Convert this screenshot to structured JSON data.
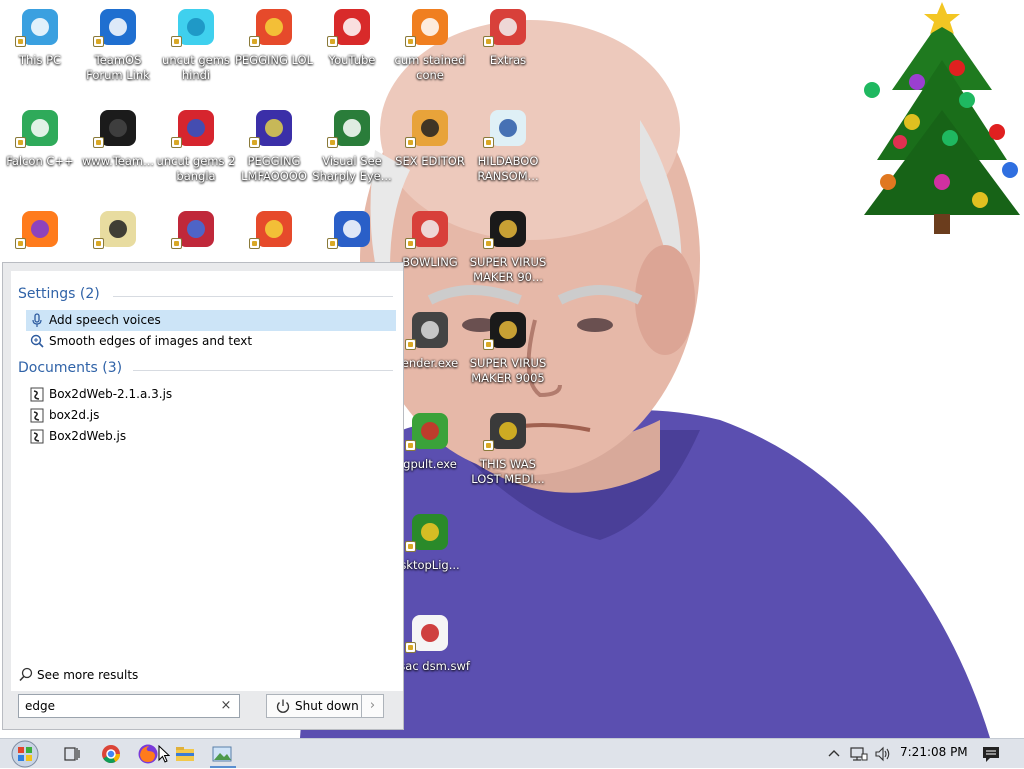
{
  "desktop": {
    "icons": [
      {
        "label": "This PC",
        "icon": "monitor-icon"
      },
      {
        "label": "TeamOS Forum Link",
        "icon": "gear-icon"
      },
      {
        "label": "uncut gems hindi",
        "icon": "diamond-icon"
      },
      {
        "label": "PEGGING LOL",
        "icon": "peggle-icon"
      },
      {
        "label": "YouTube",
        "icon": "angry-bird-icon"
      },
      {
        "label": "cum stained cone",
        "icon": "traffic-cone-icon"
      },
      {
        "label": "Extras",
        "icon": "red-folder-icon"
      },
      {
        "label": "Falcon C++",
        "icon": "recycle-icon"
      },
      {
        "label": "www.Team...",
        "icon": "black-box-icon"
      },
      {
        "label": "uncut gems 2 bangla",
        "icon": "number-two-icon"
      },
      {
        "label": "PEGGING LMFAOOOO",
        "icon": "orb-icon"
      },
      {
        "label": "Visual See Sharply Eye...",
        "icon": "csharp-icon"
      },
      {
        "label": "SEX EDITOR",
        "icon": "hex-editor-icon"
      },
      {
        "label": "HILDABOO RANSOM...",
        "icon": "script-icon"
      },
      {
        "label": "",
        "icon": "firefox-icon"
      },
      {
        "label": "",
        "icon": "pixel-face-icon"
      },
      {
        "label": "",
        "icon": "bejeweled-icon"
      },
      {
        "label": "",
        "icon": "peggle-icon"
      },
      {
        "label": "",
        "icon": "vb-icon"
      },
      {
        "label": "BOWLING",
        "icon": "red-folder-icon"
      },
      {
        "label": "SUPER VIRUS MAKER 90...",
        "icon": "camera-bag-icon"
      },
      {
        "label": "ender.exe",
        "icon": "robot-icon"
      },
      {
        "label": "SUPER VIRUS MAKER 9005",
        "icon": "camera-bag-icon"
      },
      {
        "label": "gpult.exe",
        "icon": "frog-icon"
      },
      {
        "label": "THIS WAS LOST MEDI...",
        "icon": "colorful-block-icon"
      },
      {
        "label": "sktopLig...",
        "icon": "christmas-tree-icon"
      },
      {
        "label": "issac dsm.swf",
        "icon": "flash-file-icon"
      }
    ]
  },
  "start_menu": {
    "settings_header": "Settings (2)",
    "settings_items": [
      "Add speech voices",
      "Smooth edges of images and text"
    ],
    "documents_header": "Documents (3)",
    "documents_items": [
      "Box2dWeb-2.1.a.3.js",
      "box2d.js",
      "Box2dWeb.js"
    ],
    "see_more": "See more results",
    "search_value": "edge",
    "clear_symbol": "×",
    "shutdown_label": "Shut down",
    "shutdown_arrow": "›"
  },
  "taskbar": {
    "clock": "7:21:08 PM",
    "apps": [
      "start-orb-icon",
      "task-view-icon",
      "chrome-icon",
      "firefox-icon",
      "file-explorer-icon",
      "photo-viewer-icon"
    ],
    "tray": [
      "chevron-up-icon",
      "network-icon",
      "volume-icon",
      "notification-icon"
    ]
  },
  "colors": {
    "header_blue": "#3063a8",
    "selection": "#cce4f7",
    "taskbar": "#dfe3ea",
    "shirt": "#5b4fb0"
  }
}
